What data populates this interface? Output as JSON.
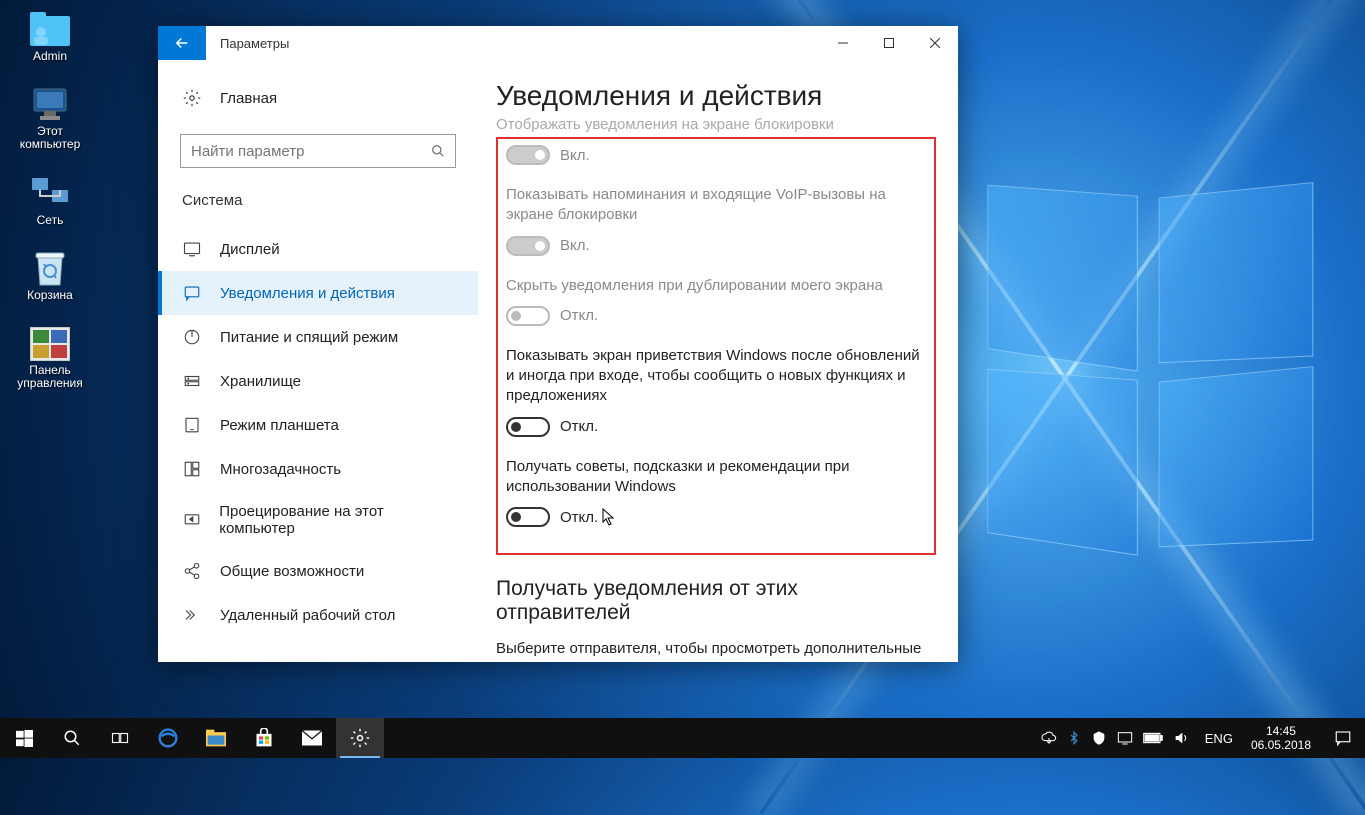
{
  "desktop_icons": [
    {
      "label": "Admin"
    },
    {
      "label": "Этот\nкомпьютер"
    },
    {
      "label": "Сеть"
    },
    {
      "label": "Корзина"
    },
    {
      "label": "Панель\nуправления"
    }
  ],
  "window": {
    "title": "Параметры",
    "home": "Главная",
    "search_placeholder": "Найти параметр",
    "section": "Система",
    "nav": [
      "Дисплей",
      "Уведомления и действия",
      "Питание и спящий режим",
      "Хранилище",
      "Режим планшета",
      "Многозадачность",
      "Проецирование на этот компьютер",
      "Общие возможности",
      "Удаленный рабочий стол"
    ],
    "content_heading": "Уведомления и действия",
    "scroll_cutoff": "Отображать уведомления на экране блокировки",
    "settings": [
      {
        "label": "",
        "state": "Вкл.",
        "disabled": true,
        "on": true
      },
      {
        "label": "Показывать напоминания и входящие VoIP-вызовы на экране блокировки",
        "state": "Вкл.",
        "disabled": true,
        "on": true
      },
      {
        "label": "Скрыть уведомления при дублировании моего экрана",
        "state": "Откл.",
        "disabled": true,
        "on": false
      },
      {
        "label": "Показывать экран приветствия Windows после обновлений и иногда при входе, чтобы сообщить о новых функциях и предложениях",
        "state": "Откл.",
        "disabled": false,
        "on": false
      },
      {
        "label": "Получать советы, подсказки и рекомендации при использовании Windows",
        "state": "Откл.",
        "disabled": false,
        "on": false
      }
    ],
    "senders_heading": "Получать уведомления от этих отправителей",
    "senders_text": "Выберите отправителя, чтобы просмотреть дополнительные параметры. У некоторых отправителей также могут быть собственные параметры уведомлений. Если это так, откройте"
  },
  "taskbar": {
    "lang": "ENG",
    "time": "14:45",
    "date": "06.05.2018"
  }
}
